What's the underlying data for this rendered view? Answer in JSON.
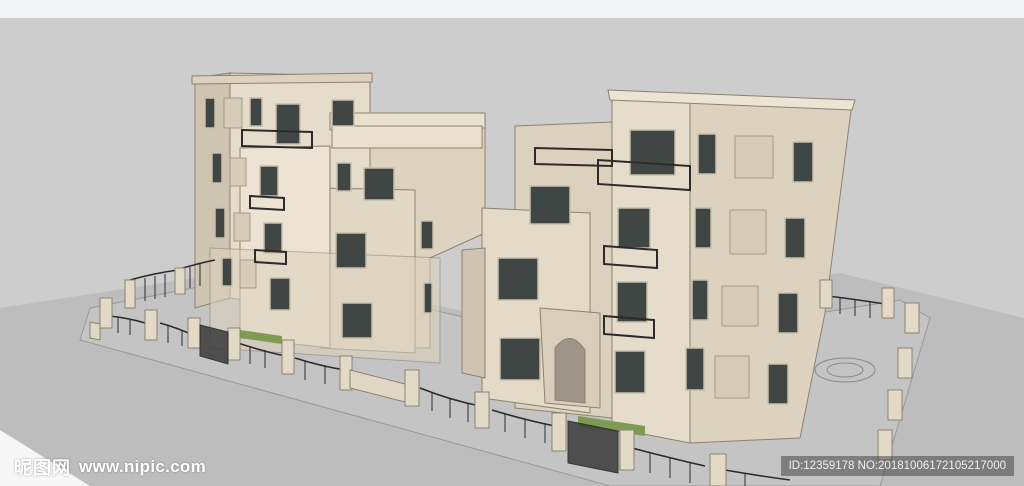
{
  "watermark": {
    "logo_text": "昵图网",
    "site_url": "www.nipic.com",
    "image_info": "ID:12359178 NO:20181006172105217000"
  },
  "colors": {
    "background": "#cdcdcd",
    "ground": "#b9b9b9",
    "wall_light": "#e6dccb",
    "wall_shadow": "#cfc4b1",
    "trim": "#8c8271",
    "glass": "#3f4643",
    "fence": "#2b2b2b",
    "hedge": "#7f9b53",
    "topbar": "#f2f3f4"
  },
  "icons": {
    "logo": "nipic-logo-icon"
  }
}
